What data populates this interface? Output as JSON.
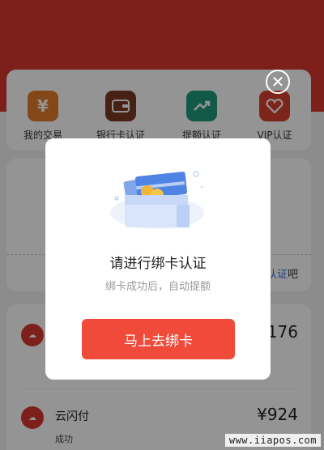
{
  "menu": {
    "items": [
      {
        "label": "我的交易",
        "icon": "yen-icon",
        "glyph": "¥",
        "color": "#e47b2a"
      },
      {
        "label": "银行卡认证",
        "icon": "wallet-icon",
        "glyph": "▣",
        "color": "#7a3a22"
      },
      {
        "label": "提额认证",
        "icon": "trend-up-icon",
        "glyph": "↗",
        "color": "#1f9c7a"
      },
      {
        "label": "VIP认证",
        "icon": "vip-heart-icon",
        "glyph": "❤",
        "color": "#d8402d"
      }
    ]
  },
  "mid_card": {
    "link_highlight": "认证",
    "link_suffix": "吧"
  },
  "transactions": [
    {
      "name": "",
      "status": "",
      "amount": "176"
    },
    {
      "name": "云闪付",
      "status": "成功",
      "amount": "¥924"
    }
  ],
  "dialog": {
    "title": "请进行绑卡认证",
    "subtitle": "绑卡成功后，自动提额",
    "button_label": "马上去绑卡",
    "close_icon": "close-icon"
  },
  "watermark": "www.iiapos.com"
}
